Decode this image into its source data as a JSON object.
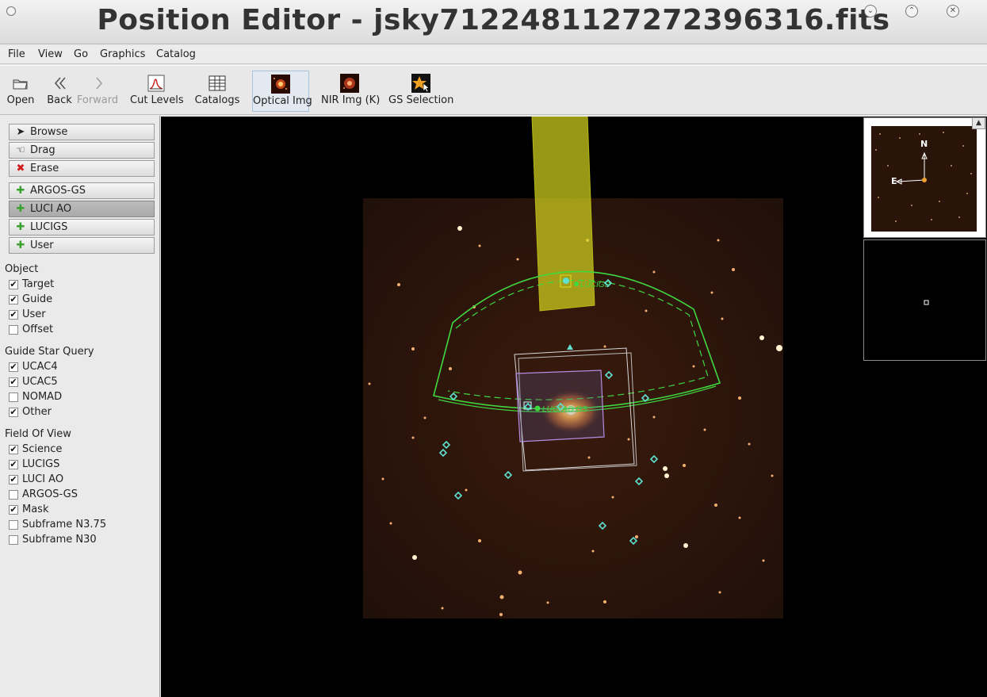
{
  "window": {
    "title": "Position Editor - jsky7122481127272396316.fits"
  },
  "menu": [
    "File",
    "View",
    "Go",
    "Graphics",
    "Catalog"
  ],
  "toolbar": {
    "open": "Open",
    "back": "Back",
    "forward": "Forward",
    "cut_levels": "Cut Levels",
    "catalogs": "Catalogs",
    "optical_img": "Optical Img",
    "nir_img": "NIR Img (K)",
    "gs_selection": "GS Selection"
  },
  "tools": {
    "browse": "Browse",
    "drag": "Drag",
    "erase": "Erase"
  },
  "probes": [
    "ARGOS-GS",
    "LUCI AO",
    "LUCIGS",
    "User"
  ],
  "object_group": {
    "title": "Object",
    "items": [
      {
        "label": "Target",
        "checked": true
      },
      {
        "label": "Guide",
        "checked": true
      },
      {
        "label": "User",
        "checked": true
      },
      {
        "label": "Offset",
        "checked": false
      }
    ]
  },
  "guide_query_group": {
    "title": "Guide Star Query",
    "items": [
      {
        "label": "UCAC4",
        "checked": true
      },
      {
        "label": "UCAC5",
        "checked": true
      },
      {
        "label": "NOMAD",
        "checked": false
      },
      {
        "label": "Other",
        "checked": true
      }
    ]
  },
  "fov_group": {
    "title": "Field Of View",
    "items": [
      {
        "label": "Science",
        "checked": true
      },
      {
        "label": "LUCIGS",
        "checked": true
      },
      {
        "label": "LUCI AO",
        "checked": true
      },
      {
        "label": "ARGOS-GS",
        "checked": false
      },
      {
        "label": "Mask",
        "checked": true
      },
      {
        "label": "Subframe N3.75",
        "checked": false
      },
      {
        "label": "Subframe N30",
        "checked": false
      }
    ]
  },
  "overlay_labels": {
    "lucigs_top": "LUCIGS",
    "luci_center": "LUCI AO GS"
  },
  "panner": {
    "north": "N",
    "east": "E"
  },
  "colors": {
    "overlay_green": "#3fd83f",
    "probe_yellow": "#d2d21e",
    "mask_purple": "#b68ce0",
    "candidate_cyan": "#5fe0d0"
  }
}
